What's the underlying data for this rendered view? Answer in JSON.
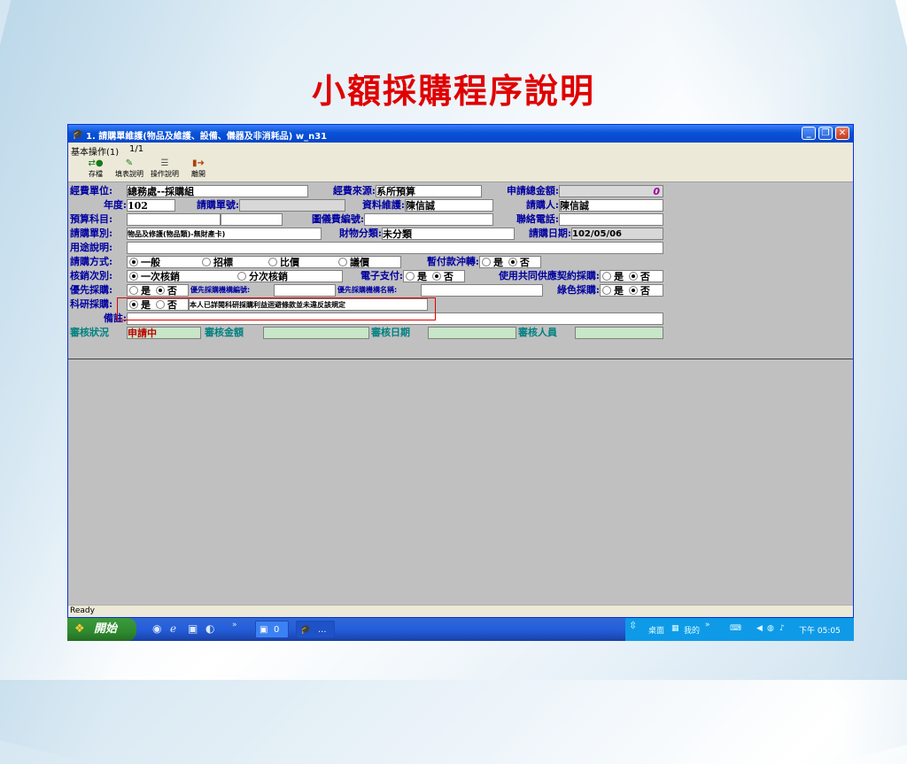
{
  "slide": {
    "title": "小額採購程序說明"
  },
  "window": {
    "title": "1. 請購單維護(物品及維護、設備、儀器及非消耗品) w_n31",
    "buttons": {
      "minimize": "_",
      "restore": "❐",
      "close": "✕"
    },
    "menu": {
      "item1": "基本操作(1)",
      "page": "1/1"
    },
    "toolbar": [
      {
        "label": "存檔",
        "icon": "save-icon"
      },
      {
        "label": "填表說明",
        "icon": "form-help-icon"
      },
      {
        "label": "操作說明",
        "icon": "operation-help-icon"
      },
      {
        "label": "離開",
        "icon": "exit-icon"
      }
    ],
    "status": "Ready"
  },
  "form": {
    "funding_unit": {
      "label": "經費單位:",
      "value": "總務處--採購組"
    },
    "funding_source": {
      "label": "經費來源:",
      "value": "系所預算"
    },
    "total_amount": {
      "label": "申請總金額:",
      "value": "0"
    },
    "year": {
      "label": "年度:",
      "value": "102"
    },
    "requisition_no": {
      "label": "請購單號:",
      "value": ""
    },
    "data_maintainer": {
      "label": "資料維護:",
      "value": "陳信誠"
    },
    "requester": {
      "label": "請購人:",
      "value": "陳信誠"
    },
    "budget_item": {
      "label": "預算科目:",
      "value": ""
    },
    "library_no": {
      "label": "圖儀費編號:",
      "value": ""
    },
    "phone": {
      "label": "聯絡電話:",
      "value": ""
    },
    "requisition_type": {
      "label": "請購單別:",
      "value": "物品及修護(物品類)-無財產卡)"
    },
    "property_class": {
      "label": "財物分類:",
      "value": "未分類"
    },
    "requisition_date": {
      "label": "請購日期:",
      "value": "102/05/06"
    },
    "usage_desc": {
      "label": "用途說明:",
      "value": ""
    },
    "purchase_method": {
      "label": "請購方式:",
      "options": [
        "一般",
        "招標",
        "比價",
        "議價"
      ],
      "selected": "一般"
    },
    "advance_payment": {
      "label": "暫付款沖轉:",
      "options": [
        "是",
        "否"
      ],
      "selected": "否"
    },
    "settlement": {
      "label": "核銷次別:",
      "options": [
        "一次核銷",
        "分次核銷"
      ],
      "selected": "一次核銷"
    },
    "e_payment": {
      "label": "電子支付:",
      "options": [
        "是",
        "否"
      ],
      "selected": "否"
    },
    "shared_contract": {
      "label": "使用共同供應契約採購:",
      "options": [
        "是",
        "否"
      ],
      "selected": "否"
    },
    "priority_purchase": {
      "label": "優先採購:",
      "options": [
        "是",
        "否"
      ],
      "selected": "否"
    },
    "priority_org_no": {
      "label": "優先採購機構編號:",
      "value": ""
    },
    "priority_org_name": {
      "label": "優先採購機構名稱:",
      "value": ""
    },
    "green_purchase": {
      "label": "綠色採購:",
      "options": [
        "是",
        "否"
      ],
      "selected": "否"
    },
    "research_purchase": {
      "label": "科研採購:",
      "options": [
        "是",
        "否"
      ],
      "selected": "是"
    },
    "research_note": "本人已詳閱科研採購利益迴避條款並未違反該規定",
    "remark": {
      "label": "備註:",
      "value": ""
    },
    "review_status": {
      "label": "審核狀況",
      "value": "申請中"
    },
    "review_amount": {
      "label": "審核金額",
      "value": ""
    },
    "review_date": {
      "label": "審核日期",
      "value": ""
    },
    "reviewer": {
      "label": "審核人員",
      "value": ""
    }
  },
  "taskbar": {
    "start": "開始",
    "window_button": "0",
    "task_button": "...",
    "tray": {
      "desktop": "桌面",
      "mine": "我的",
      "time": "下午 05:05"
    }
  },
  "colors": {
    "label_blue": "#0000a0",
    "value_red": "#c00000",
    "review_green": "#c8e6c8",
    "amount_purple": "#a000a0",
    "highlight_red": "#e00000"
  }
}
